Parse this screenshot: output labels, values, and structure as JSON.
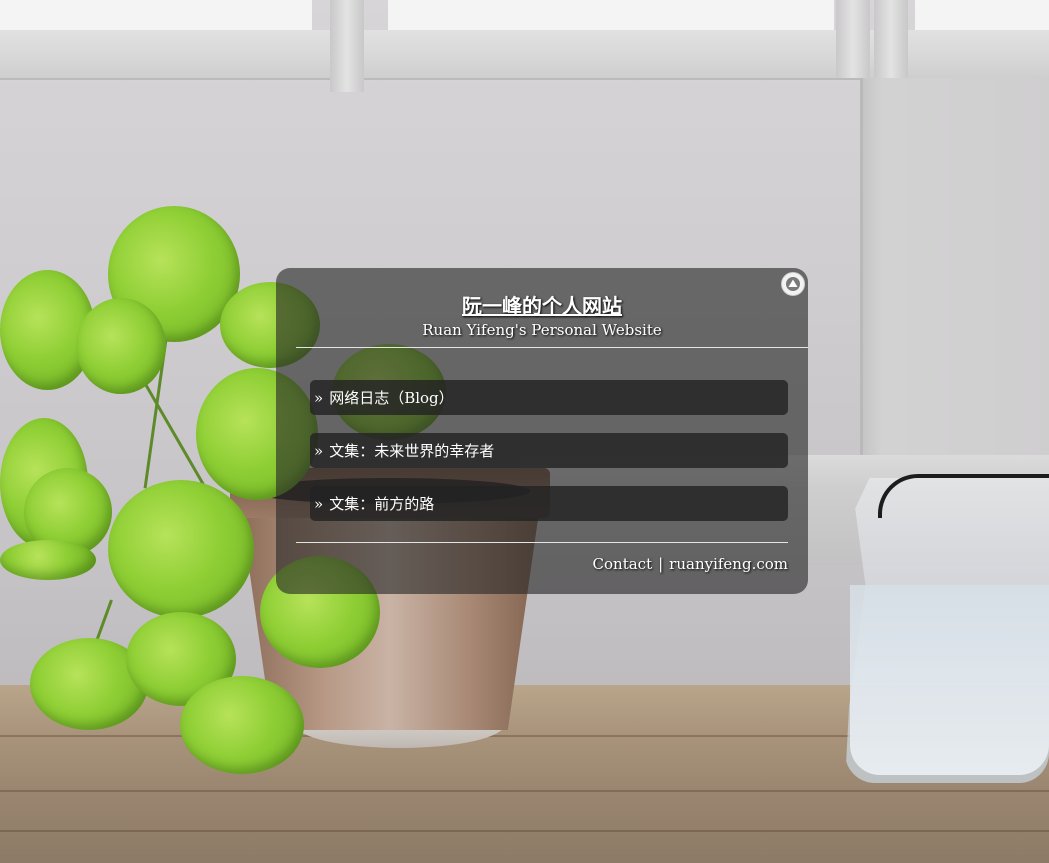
{
  "panel": {
    "title": "阮一峰的个人网站",
    "subtitle": "Ruan Yifeng's Personal Website",
    "collapse_icon": "triangle-up-icon",
    "links": [
      {
        "bullet": "»",
        "label": "网络日志（Blog）"
      },
      {
        "bullet": "»",
        "label": "文集：未来世界的幸存者"
      },
      {
        "bullet": "»",
        "label": "文集：前方的路"
      }
    ],
    "footer": {
      "contact_label": "Contact",
      "separator": "|",
      "site_label": "ruanyifeng.com"
    }
  },
  "colors": {
    "panel_bg": "#282828",
    "text": "#ffffff",
    "rule": "#e4e4e4"
  }
}
